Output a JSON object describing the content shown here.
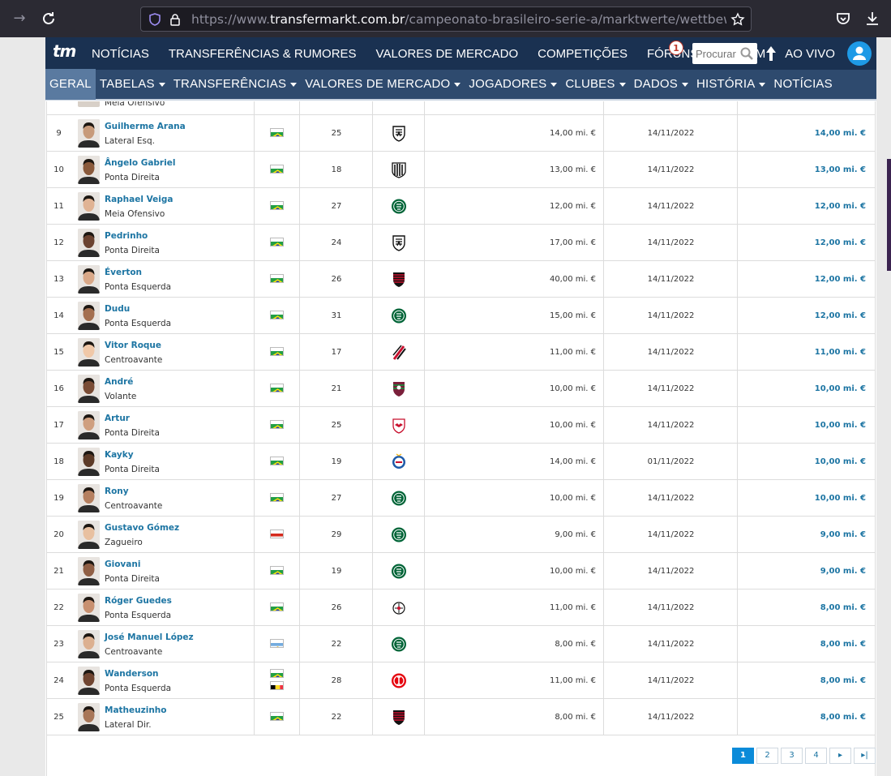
{
  "browser": {
    "url_prefix": "https://www.",
    "url_host": "transfermarkt.com.br",
    "url_path": "/campeonato-brasileiro-serie-a/marktwerte/wettbewerb/BR"
  },
  "header": {
    "logo": "tm",
    "nav": [
      "NOTÍCIAS",
      "TRANSFERÊNCIAS & RUMORES",
      "VALORES DE MERCADO",
      "COMPETIÇÕES",
      "FÓRUNS",
      "MEU TM",
      "AO VIVO"
    ],
    "live_count": "1",
    "search_placeholder": "Procurar j"
  },
  "subnav": {
    "items": [
      {
        "label": "GERAL",
        "caret": false,
        "active": true
      },
      {
        "label": "TABELAS",
        "caret": true
      },
      {
        "label": "TRANSFERÊNCIAS",
        "caret": true
      },
      {
        "label": "VALORES DE MERCADO",
        "caret": true
      },
      {
        "label": "JOGADORES",
        "caret": true
      },
      {
        "label": "CLUBES",
        "caret": true
      },
      {
        "label": "DADOS",
        "caret": true
      },
      {
        "label": "HISTÓRIA",
        "caret": true
      },
      {
        "label": "NOTÍCIAS",
        "caret": false
      }
    ]
  },
  "partial_row": {
    "position": "Meia Ofensivo"
  },
  "rows": [
    {
      "rank": "9",
      "name": "Guilherme Arana",
      "position": "Lateral Esq.",
      "nationality": [
        "brazil"
      ],
      "age": "25",
      "club": "atletico-mg",
      "prev_value": "14,00 mi. €",
      "date": "14/11/2022",
      "value": "14,00 mi. €"
    },
    {
      "rank": "10",
      "name": "Ângelo Gabriel",
      "position": "Ponta Direita",
      "nationality": [
        "brazil"
      ],
      "age": "18",
      "club": "santos",
      "prev_value": "13,00 mi. €",
      "date": "14/11/2022",
      "value": "13,00 mi. €"
    },
    {
      "rank": "11",
      "name": "Raphael Veiga",
      "position": "Meia Ofensivo",
      "nationality": [
        "brazil"
      ],
      "age": "27",
      "club": "palmeiras",
      "prev_value": "12,00 mi. €",
      "date": "14/11/2022",
      "value": "12,00 mi. €"
    },
    {
      "rank": "12",
      "name": "Pedrinho",
      "position": "Ponta Direita",
      "nationality": [
        "brazil"
      ],
      "age": "24",
      "club": "atletico-mg",
      "prev_value": "17,00 mi. €",
      "date": "14/11/2022",
      "value": "12,00 mi. €"
    },
    {
      "rank": "13",
      "name": "Éverton",
      "position": "Ponta Esquerda",
      "nationality": [
        "brazil"
      ],
      "age": "26",
      "club": "flamengo",
      "prev_value": "40,00 mi. €",
      "date": "14/11/2022",
      "value": "12,00 mi. €"
    },
    {
      "rank": "14",
      "name": "Dudu",
      "position": "Ponta Esquerda",
      "nationality": [
        "brazil"
      ],
      "age": "31",
      "club": "palmeiras",
      "prev_value": "15,00 mi. €",
      "date": "14/11/2022",
      "value": "12,00 mi. €"
    },
    {
      "rank": "15",
      "name": "Vitor Roque",
      "position": "Centroavante",
      "nationality": [
        "brazil"
      ],
      "age": "17",
      "club": "athletico-pr",
      "prev_value": "11,00 mi. €",
      "date": "14/11/2022",
      "value": "11,00 mi. €"
    },
    {
      "rank": "16",
      "name": "André",
      "position": "Volante",
      "nationality": [
        "brazil"
      ],
      "age": "21",
      "club": "fluminense",
      "prev_value": "10,00 mi. €",
      "date": "14/11/2022",
      "value": "10,00 mi. €"
    },
    {
      "rank": "17",
      "name": "Artur",
      "position": "Ponta Direita",
      "nationality": [
        "brazil"
      ],
      "age": "25",
      "club": "bragantino",
      "prev_value": "10,00 mi. €",
      "date": "14/11/2022",
      "value": "10,00 mi. €"
    },
    {
      "rank": "18",
      "name": "Kayky",
      "position": "Ponta Direita",
      "nationality": [
        "brazil"
      ],
      "age": "19",
      "club": "bahia",
      "prev_value": "14,00 mi. €",
      "date": "01/11/2022",
      "value": "10,00 mi. €"
    },
    {
      "rank": "19",
      "name": "Rony",
      "position": "Centroavante",
      "nationality": [
        "brazil"
      ],
      "age": "27",
      "club": "palmeiras",
      "prev_value": "10,00 mi. €",
      "date": "14/11/2022",
      "value": "10,00 mi. €"
    },
    {
      "rank": "20",
      "name": "Gustavo Gómez",
      "position": "Zagueiro",
      "nationality": [
        "paraguay"
      ],
      "age": "29",
      "club": "palmeiras",
      "prev_value": "9,00 mi. €",
      "date": "14/11/2022",
      "value": "9,00 mi. €"
    },
    {
      "rank": "21",
      "name": "Giovani",
      "position": "Ponta Direita",
      "nationality": [
        "brazil"
      ],
      "age": "19",
      "club": "palmeiras",
      "prev_value": "10,00 mi. €",
      "date": "14/11/2022",
      "value": "9,00 mi. €"
    },
    {
      "rank": "22",
      "name": "Róger Guedes",
      "position": "Ponta Esquerda",
      "nationality": [
        "brazil"
      ],
      "age": "26",
      "club": "corinthians",
      "prev_value": "11,00 mi. €",
      "date": "14/11/2022",
      "value": "8,00 mi. €"
    },
    {
      "rank": "23",
      "name": "José Manuel López",
      "position": "Centroavante",
      "nationality": [
        "argentina"
      ],
      "age": "22",
      "club": "palmeiras",
      "prev_value": "8,00 mi. €",
      "date": "14/11/2022",
      "value": "8,00 mi. €"
    },
    {
      "rank": "24",
      "name": "Wanderson",
      "position": "Ponta Esquerda",
      "nationality": [
        "brazil",
        "belgium"
      ],
      "age": "28",
      "club": "internacional",
      "prev_value": "11,00 mi. €",
      "date": "14/11/2022",
      "value": "8,00 mi. €"
    },
    {
      "rank": "25",
      "name": "Matheuzinho",
      "position": "Lateral Dir.",
      "nationality": [
        "brazil"
      ],
      "age": "22",
      "club": "flamengo",
      "prev_value": "8,00 mi. €",
      "date": "14/11/2022",
      "value": "8,00 mi. €"
    }
  ],
  "pagination": {
    "pages": [
      "1",
      "2",
      "3",
      "4"
    ],
    "current": "1",
    "next": "▸",
    "last": "⏭"
  },
  "colors": {
    "header": "#1a3151",
    "subnav": "#2e4a6e",
    "link": "#1d75a3",
    "active_page": "#0b8bd9"
  }
}
